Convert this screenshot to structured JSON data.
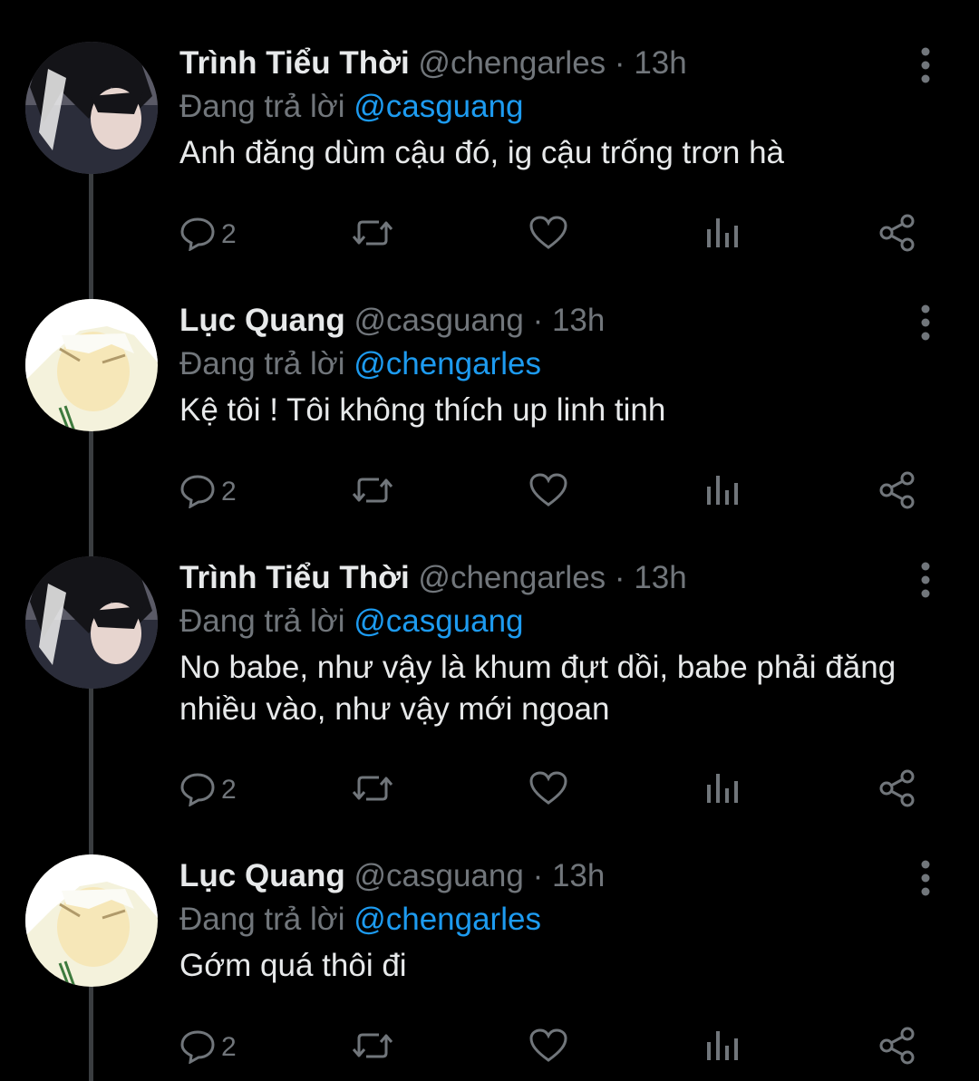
{
  "colors": {
    "background": "#000000",
    "name": "#e7e9ea",
    "secondary": "#71767b",
    "mention": "#1d9bf0",
    "thread_line": "#3a3d40"
  },
  "tweets": [
    {
      "name": "Trình Tiểu Thời",
      "handle": "@chengarles",
      "dot": "·",
      "time": "13h",
      "reply_prefix": "Đang trả lời",
      "reply_to": "@casguang",
      "text": "Anh đăng dùm cậu đó, ig cậu trống trơn hà",
      "reply_count": "2",
      "avatar": "dark-hair-avatar"
    },
    {
      "name": "Lục Quang",
      "handle": "@casguang",
      "dot": "·",
      "time": "13h",
      "reply_prefix": "Đang trả lời",
      "reply_to": "@chengarles",
      "text": "Kệ tôi ! Tôi không thích up linh tinh",
      "reply_count": "2",
      "avatar": "white-hair-avatar"
    },
    {
      "name": "Trình Tiểu Thời",
      "handle": "@chengarles",
      "dot": "·",
      "time": "13h",
      "reply_prefix": "Đang trả lời",
      "reply_to": "@casguang",
      "text": "No babe, như vậy là khum đựt dồi, babe phải đăng nhiều vào, như vậy mới ngoan",
      "reply_count": "2",
      "avatar": "dark-hair-avatar"
    },
    {
      "name": "Lục Quang",
      "handle": "@casguang",
      "dot": "·",
      "time": "13h",
      "reply_prefix": "Đang trả lời",
      "reply_to": "@chengarles",
      "text": "Gớm quá thôi đi",
      "reply_count": "2",
      "avatar": "white-hair-avatar"
    }
  ]
}
